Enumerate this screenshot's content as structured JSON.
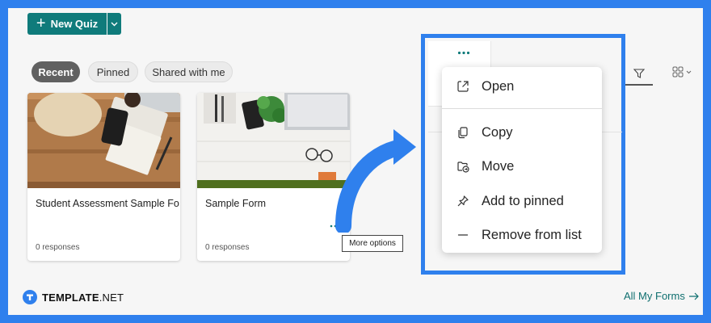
{
  "toolbar": {
    "new_quiz_label": "New Quiz"
  },
  "filters": {
    "recent": "Recent",
    "pinned": "Pinned",
    "shared": "Shared with me"
  },
  "cards": [
    {
      "title": "Student Assessment Sample Fo",
      "responses": "0 responses"
    },
    {
      "title": "Sample Form",
      "responses": "0 responses"
    }
  ],
  "tooltip": "More options",
  "context_menu": {
    "items": [
      {
        "label": "Open",
        "icon": "open-external-icon"
      },
      {
        "label": "Copy",
        "icon": "copy-icon"
      },
      {
        "label": "Move",
        "icon": "move-folder-icon"
      },
      {
        "label": "Add to pinned",
        "icon": "pin-icon"
      },
      {
        "label": "Remove from list",
        "icon": "minus-icon"
      }
    ]
  },
  "footer": {
    "brand": "TEMPLATE",
    "brand_suffix": ".NET",
    "all_forms_link": "All My Forms"
  },
  "colors": {
    "brand_teal": "#0f7b7b",
    "callout_blue": "#2f80ed",
    "background": "#f6f6f6"
  }
}
